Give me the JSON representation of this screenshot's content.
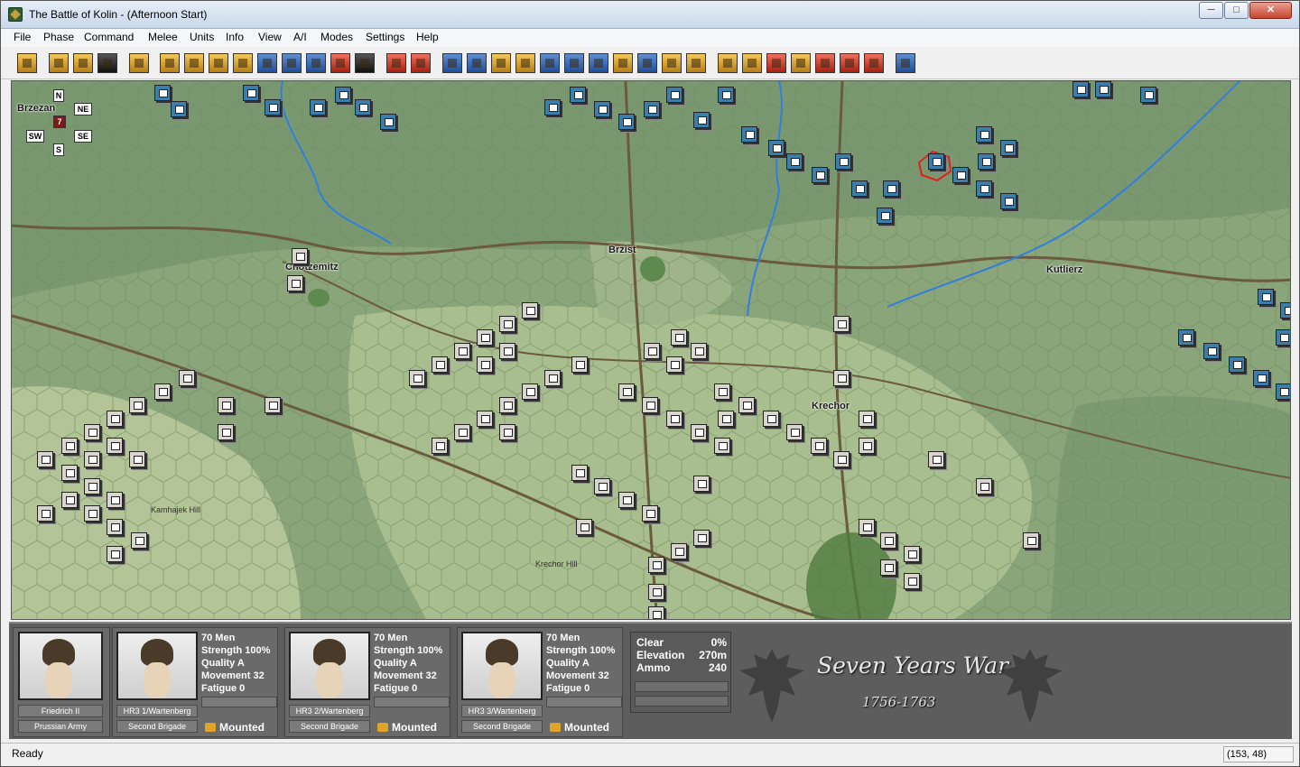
{
  "window": {
    "title": "The Battle of Kolin - (Afternoon Start)",
    "min": "─",
    "max": "□",
    "close": "✕"
  },
  "menu": [
    "File",
    "Phase",
    "Command",
    "Melee",
    "Units",
    "Info",
    "View",
    "A/I",
    "Modes",
    "Settings",
    "Help"
  ],
  "map": {
    "places": [
      "Brzezan",
      "Chotzemitz",
      "Brzist",
      "Kutlierz",
      "Krechor"
    ],
    "hills": [
      "Kamhajek Hill",
      "Krechor Hill"
    ],
    "compass": {
      "n": "N",
      "ne": "NE",
      "se": "SE",
      "s": "S",
      "sw": "SW",
      "current": "7"
    }
  },
  "leader": {
    "name": "Friedrich II",
    "army": "Prussian Army"
  },
  "units": [
    {
      "name": "HR3 1/Wartenberg",
      "brigade": "Second Brigade",
      "men": "70 Men",
      "strength": "Strength 100%",
      "quality": "Quality A",
      "movement": "Movement 32",
      "fatigue": "Fatigue 0",
      "status": "Mounted"
    },
    {
      "name": "HR3 2/Wartenberg",
      "brigade": "Second Brigade",
      "men": "70 Men",
      "strength": "Strength 100%",
      "quality": "Quality A",
      "movement": "Movement 32",
      "fatigue": "Fatigue 0",
      "status": "Mounted"
    },
    {
      "name": "HR3 3/Wartenberg",
      "brigade": "Second Brigade",
      "men": "70 Men",
      "strength": "Strength 100%",
      "quality": "Quality A",
      "movement": "Movement 32",
      "fatigue": "Fatigue 0",
      "status": "Mounted"
    }
  ],
  "terrain": {
    "type": "Clear",
    "type_val": "0%",
    "elev_label": "Elevation",
    "elev_val": "270m",
    "ammo_label": "Ammo",
    "ammo_val": "240"
  },
  "logo": {
    "title": "Seven Years War",
    "years": "1756-1763"
  },
  "status": {
    "text": "Ready",
    "coords": "(153, 48)"
  }
}
